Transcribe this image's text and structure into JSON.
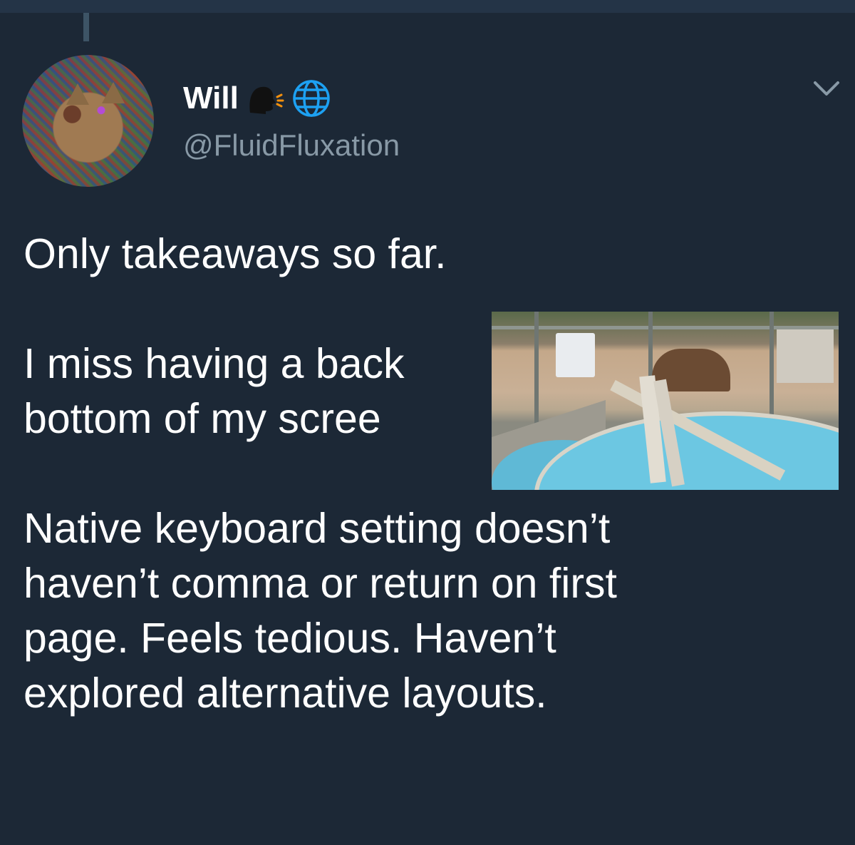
{
  "tweet": {
    "author": {
      "display_name": "Will",
      "handle": "@FluidFluxation",
      "avatar_icon": "cat-portrait-avatar",
      "name_emojis": [
        "speaking-head-icon",
        "globe-icon"
      ]
    },
    "paragraphs": [
      "Only takeaways so far.",
      "I miss having a back\nbottom of my scree",
      "Native keyboard setting doesn’t\nhaven’t comma or return on first\npage. Feels tedious. Haven’t\nexplored alternative layouts."
    ],
    "media": {
      "type": "video-thumbnail",
      "icon": "video-overlay"
    },
    "menu_icon": "chevron-down-icon"
  },
  "colors": {
    "background": "#1c2836",
    "text": "#ffffff",
    "secondary_text": "#8899a6",
    "thread_line": "#3d5466",
    "globe": "#1da1f2"
  }
}
